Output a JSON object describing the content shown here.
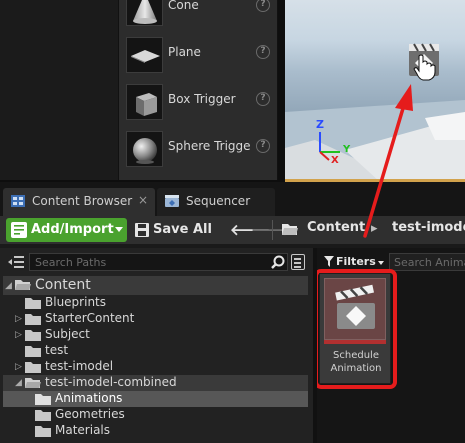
{
  "place_actors": {
    "items": [
      {
        "label": "Cone",
        "icon": "cone-icon"
      },
      {
        "label": "Plane",
        "icon": "plane-icon"
      },
      {
        "label": "Box Trigger",
        "icon": "box-trigger-icon"
      },
      {
        "label": "Sphere Trigge",
        "icon": "sphere-trigger-icon"
      }
    ],
    "help_glyph": "?"
  },
  "viewport": {
    "axis_x": "X",
    "axis_y": "Y",
    "axis_z": "Z"
  },
  "tabs": [
    {
      "label": "Content Browser",
      "icon": "content-browser-icon",
      "active": true,
      "close": "×"
    },
    {
      "label": "Sequencer",
      "icon": "sequencer-icon",
      "active": false
    }
  ],
  "toolbar": {
    "add_import_label": "Add/Import",
    "save_all_label": "Save All",
    "back_glyph": "🡐",
    "forward_glyph": "🡒",
    "breadcrumb": {
      "root": "Content",
      "separator": "▸",
      "current": "test-imodel"
    }
  },
  "sources": {
    "search_placeholder": "Search Paths",
    "tree": [
      {
        "label": "Content",
        "level": 0,
        "expanded": true,
        "selected": true
      },
      {
        "label": "Blueprints",
        "level": 1,
        "expandable": false
      },
      {
        "label": "StarterContent",
        "level": 1,
        "expandable": true
      },
      {
        "label": "Subject",
        "level": 1,
        "expandable": true
      },
      {
        "label": "test",
        "level": 1,
        "expandable": false
      },
      {
        "label": "test-imodel",
        "level": 1,
        "expandable": true
      },
      {
        "label": "test-imodel-combined",
        "level": 1,
        "expanded": true,
        "selected": true
      },
      {
        "label": "Animations",
        "level": 2,
        "highlight": true
      },
      {
        "label": "Geometries",
        "level": 2
      },
      {
        "label": "Materials",
        "level": 2
      }
    ]
  },
  "assets": {
    "filters_label": "Filters",
    "search_placeholder": "Search Anima",
    "items": [
      {
        "label_line1": "Schedule",
        "label_line2": "Animation",
        "icon": "clapperboard-icon",
        "highlighted": true
      }
    ]
  },
  "colors": {
    "add_button": "#4aa22e",
    "highlight_red": "#e51c1c",
    "viewport_border": "#d2a24c",
    "asset_strip": "#b23030"
  }
}
